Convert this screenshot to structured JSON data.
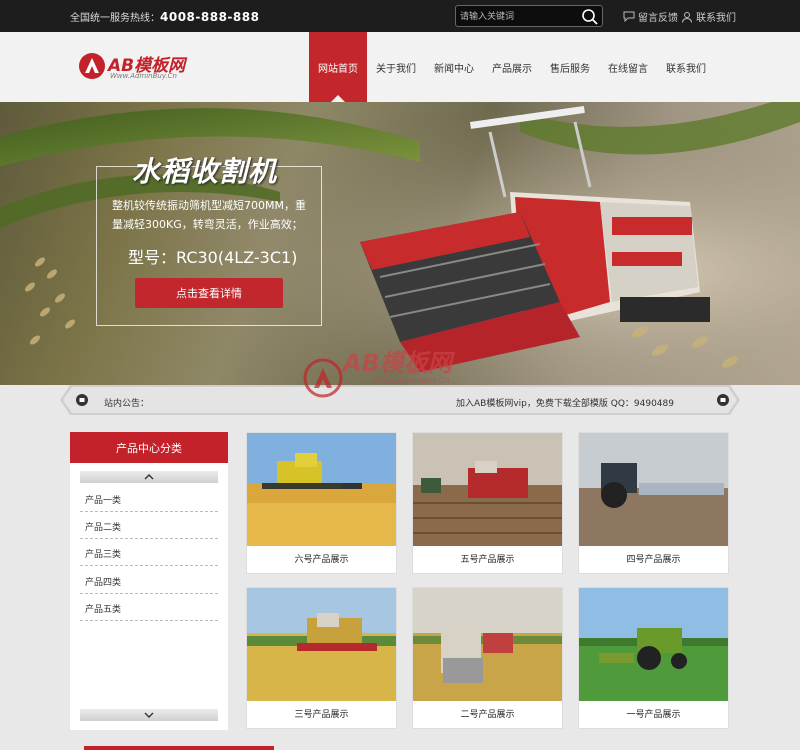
{
  "topbar": {
    "hotline_label": "全国统一服务热线：",
    "hotline_number": "4008-888-888",
    "search_placeholder": "请输入关键词",
    "feedback_label": "留言反馈",
    "contact_label": "联系我们"
  },
  "header": {
    "logo_text": "AB模板网",
    "logo_subtext": "Www.AdminBuy.Cn",
    "nav": [
      "网站首页",
      "关于我们",
      "新闻中心",
      "产品展示",
      "售后服务",
      "在线留言",
      "联系我们"
    ],
    "active_nav": 0
  },
  "banner": {
    "title": "水稻收割机",
    "description": "整机较传统振动筛机型减短700MM，重量减轻300KG，转弯灵活，作业高效；",
    "model": "型号：RC30(4LZ-3C1)",
    "button_label": "点击查看详情",
    "watermark_text": "AB模板网",
    "watermark_sub": "Www.AdminBuy.Cn"
  },
  "notice": {
    "label": "站内公告：",
    "text": "加入AB模板网vip，免费下载全部模版 QQ：9490489"
  },
  "sidebar": {
    "title": "产品中心分类",
    "up_label": "⌃",
    "down_label": "⌄",
    "items": [
      "产品一类",
      "产品二类",
      "产品三类",
      "产品四类",
      "产品五类"
    ]
  },
  "products": [
    {
      "caption": "六号产品展示"
    },
    {
      "caption": "五号产品展示"
    },
    {
      "caption": "四号产品展示"
    },
    {
      "caption": "三号产品展示"
    },
    {
      "caption": "二号产品展示"
    },
    {
      "caption": "一号产品展示"
    }
  ],
  "colors": {
    "brand_red": "#c3222a",
    "topbar_bg": "#1d1d1d",
    "header_bg": "#f2f2f2"
  }
}
